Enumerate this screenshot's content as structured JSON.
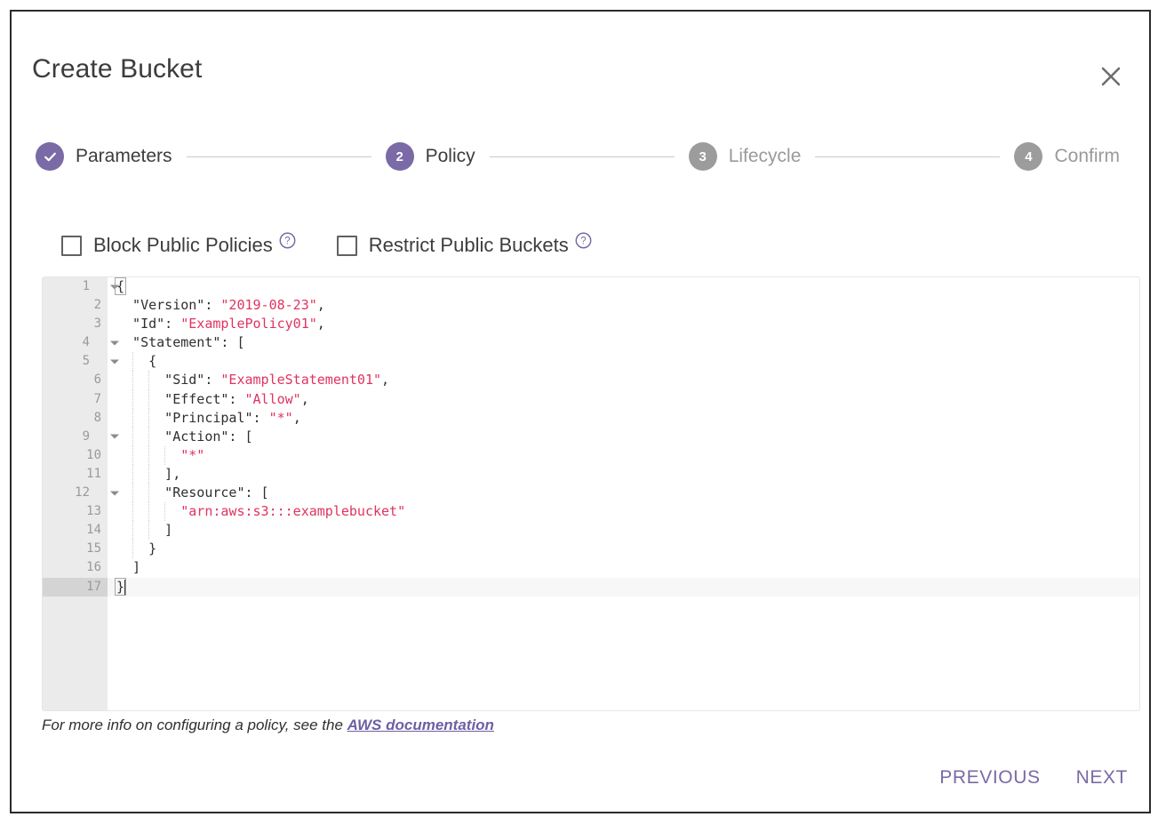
{
  "dialog": {
    "title": "Create Bucket",
    "close_icon": "close-icon"
  },
  "colors": {
    "accent_purple": "#7a6aa6",
    "inactive_grey": "#9c9c9c",
    "string_red": "#e0335f",
    "link_purple": "#6f5fa3"
  },
  "stepper": {
    "steps": [
      {
        "index": "1",
        "label": "Parameters",
        "state": "done"
      },
      {
        "index": "2",
        "label": "Policy",
        "state": "active"
      },
      {
        "index": "3",
        "label": "Lifecycle",
        "state": "todo"
      },
      {
        "index": "4",
        "label": "Confirm",
        "state": "todo"
      }
    ]
  },
  "options": {
    "checkboxes": [
      {
        "label": "Block Public Policies",
        "checked": false,
        "help_icon": "help-circle-icon"
      },
      {
        "label": "Restrict Public Buckets",
        "checked": false,
        "help_icon": "help-circle-icon"
      }
    ]
  },
  "editor": {
    "active_line": 17,
    "lines": [
      {
        "n": "1",
        "fold": true,
        "indent": 0,
        "text": "{",
        "type": "plain",
        "bracket": true
      },
      {
        "n": "2",
        "fold": false,
        "indent": 0,
        "key": "  \"Version\": ",
        "value": "\"2019-08-23\"",
        "tail": ",",
        "type": "kv"
      },
      {
        "n": "3",
        "fold": false,
        "indent": 0,
        "key": "  \"Id\": ",
        "value": "\"ExamplePolicy01\"",
        "tail": ",",
        "type": "kv"
      },
      {
        "n": "4",
        "fold": true,
        "indent": 0,
        "text": "  \"Statement\": [",
        "type": "plain"
      },
      {
        "n": "5",
        "fold": true,
        "indent": 1,
        "text": "    {",
        "type": "plain"
      },
      {
        "n": "6",
        "fold": false,
        "indent": 2,
        "key": "      \"Sid\": ",
        "value": "\"ExampleStatement01\"",
        "tail": ",",
        "type": "kv"
      },
      {
        "n": "7",
        "fold": false,
        "indent": 2,
        "key": "      \"Effect\": ",
        "value": "\"Allow\"",
        "tail": ",",
        "type": "kv"
      },
      {
        "n": "8",
        "fold": false,
        "indent": 2,
        "key": "      \"Principal\": ",
        "value": "\"*\"",
        "tail": ",",
        "type": "kv"
      },
      {
        "n": "9",
        "fold": true,
        "indent": 2,
        "text": "      \"Action\": [",
        "type": "plain"
      },
      {
        "n": "10",
        "fold": false,
        "indent": 3,
        "key": "        ",
        "value": "\"*\"",
        "tail": "",
        "type": "kv"
      },
      {
        "n": "11",
        "fold": false,
        "indent": 2,
        "text": "      ],",
        "type": "plain"
      },
      {
        "n": "12",
        "fold": true,
        "indent": 2,
        "text": "      \"Resource\": [",
        "type": "plain"
      },
      {
        "n": "13",
        "fold": false,
        "indent": 3,
        "key": "        ",
        "value": "\"arn:aws:s3:::examplebucket\"",
        "tail": "",
        "type": "kv"
      },
      {
        "n": "14",
        "fold": false,
        "indent": 2,
        "text": "      ]",
        "type": "plain"
      },
      {
        "n": "15",
        "fold": false,
        "indent": 1,
        "text": "    }",
        "type": "plain"
      },
      {
        "n": "16",
        "fold": false,
        "indent": 0,
        "text": "  ]",
        "type": "plain"
      },
      {
        "n": "17",
        "fold": false,
        "indent": 0,
        "text": "}",
        "type": "plain",
        "bracket": true,
        "caret": true
      }
    ]
  },
  "hint": {
    "text": "For more info on configuring a policy, see the ",
    "link_text": "AWS documentation"
  },
  "footer": {
    "previous_label": "PREVIOUS",
    "next_label": "NEXT"
  }
}
